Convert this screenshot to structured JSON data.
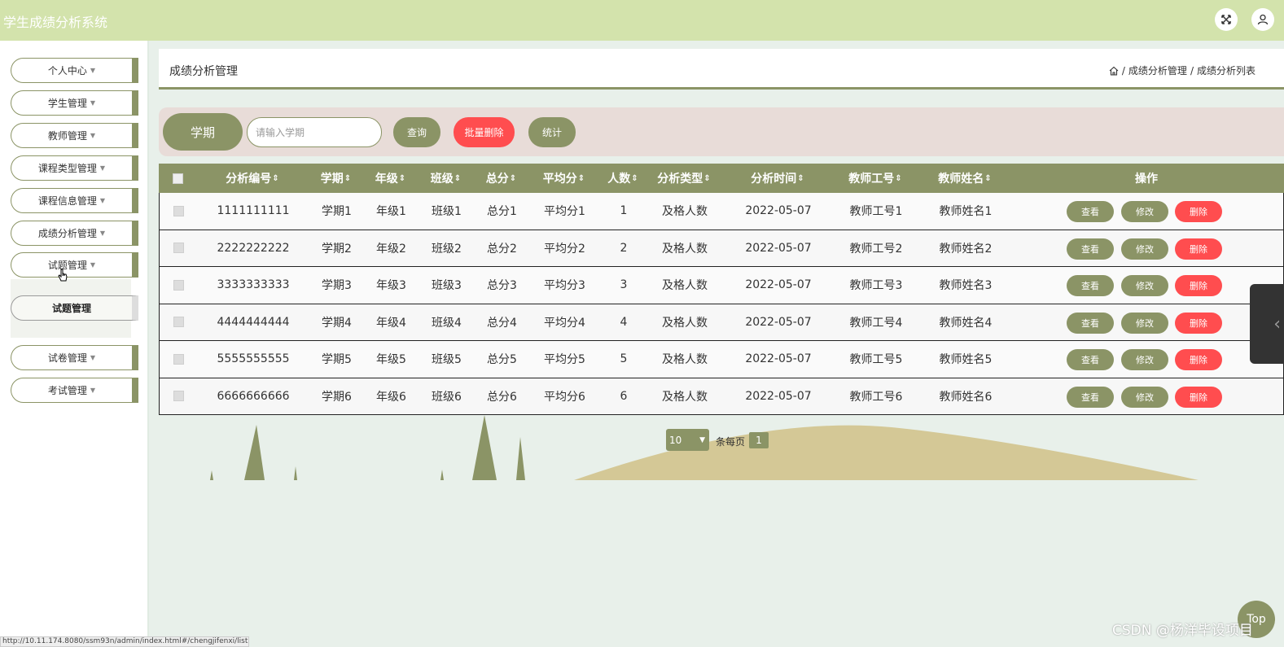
{
  "app": {
    "title": "学生成绩分析系统"
  },
  "sidebar": {
    "items": [
      {
        "label": "个人中心"
      },
      {
        "label": "学生管理"
      },
      {
        "label": "教师管理"
      },
      {
        "label": "课程类型管理"
      },
      {
        "label": "课程信息管理"
      },
      {
        "label": "成绩分析管理"
      },
      {
        "label": "试题管理"
      },
      {
        "label": "试卷管理"
      },
      {
        "label": "考试管理"
      }
    ],
    "submenu_label": "试题管理"
  },
  "header": {
    "title": "成绩分析管理",
    "breadcrumb": [
      "成绩分析管理",
      "成绩分析列表"
    ]
  },
  "search": {
    "label": "学期",
    "placeholder": "请输入学期",
    "query_label": "查询",
    "batch_delete_label": "批量删除",
    "stats_label": "统计"
  },
  "table": {
    "columns": [
      "分析编号",
      "学期",
      "年级",
      "班级",
      "总分",
      "平均分",
      "人数",
      "分析类型",
      "分析时间",
      "教师工号",
      "教师姓名",
      "操作"
    ],
    "rows": [
      [
        "1111111111",
        "学期1",
        "年级1",
        "班级1",
        "总分1",
        "平均分1",
        "1",
        "及格人数",
        "2022-05-07",
        "教师工号1",
        "教师姓名1"
      ],
      [
        "2222222222",
        "学期2",
        "年级2",
        "班级2",
        "总分2",
        "平均分2",
        "2",
        "及格人数",
        "2022-05-07",
        "教师工号2",
        "教师姓名2"
      ],
      [
        "3333333333",
        "学期3",
        "年级3",
        "班级3",
        "总分3",
        "平均分3",
        "3",
        "及格人数",
        "2022-05-07",
        "教师工号3",
        "教师姓名3"
      ],
      [
        "4444444444",
        "学期4",
        "年级4",
        "班级4",
        "总分4",
        "平均分4",
        "4",
        "及格人数",
        "2022-05-07",
        "教师工号4",
        "教师姓名4"
      ],
      [
        "5555555555",
        "学期5",
        "年级5",
        "班级5",
        "总分5",
        "平均分5",
        "5",
        "及格人数",
        "2022-05-07",
        "教师工号5",
        "教师姓名5"
      ],
      [
        "6666666666",
        "学期6",
        "年级6",
        "班级6",
        "总分6",
        "平均分6",
        "6",
        "及格人数",
        "2022-05-07",
        "教师工号6",
        "教师姓名6"
      ]
    ],
    "actions": {
      "view": "查看",
      "edit": "修改",
      "delete": "删除"
    }
  },
  "pagination": {
    "page_size": "10",
    "per_page_label": "条每页",
    "current_page": "1"
  },
  "scroll_top_label": "Top",
  "watermark": "CSDN @杨洋毕设项目",
  "status_url": "http://10.11.174.8080/ssm93n/admin/index.html#/chengjifenxi/list",
  "colors": {
    "primary": "#8b9466",
    "danger": "#ff4d4f",
    "topbar": "#d3e3ac"
  }
}
